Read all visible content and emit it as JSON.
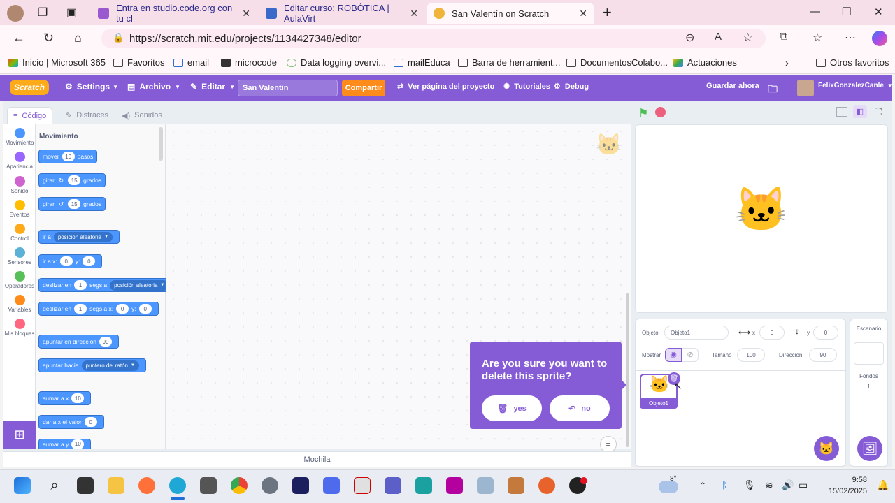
{
  "browser": {
    "tabs": [
      {
        "label": "Entra en studio.code.org con tu cl",
        "fav_color": "#9b59d0"
      },
      {
        "label": "Editar curso: ROBÓTICA | AulaVirt",
        "fav_color": "#3a6ac9"
      },
      {
        "label": "San Valentín on Scratch",
        "fav_color": "#f0b43a"
      }
    ],
    "url": "https://scratch.mit.edu/projects/1134427348/editor",
    "bookmarks": [
      "Inicio | Microsoft 365",
      "Favoritos",
      "email",
      "microcode",
      "Data logging overvi...",
      "mailEduca",
      "Barra de herramient...",
      "DocumentosColabo...",
      "Actuaciones"
    ],
    "other_favorites": "Otros favoritos"
  },
  "menubar": {
    "logo": "Scratch",
    "settings": "Settings",
    "file": "Archivo",
    "edit": "Editar",
    "project_title": "San Valentín",
    "share": "Compartir",
    "see_project": "Ver página del proyecto",
    "tutorials": "Tutoriales",
    "debug": "Debug",
    "save_now": "Guardar ahora",
    "username": "FelixGonzalezCanle"
  },
  "editor_tabs": {
    "code": "Código",
    "costumes": "Disfraces",
    "sounds": "Sonidos"
  },
  "categories": [
    {
      "label": "Movimiento",
      "color": "#4c97ff"
    },
    {
      "label": "Apariencia",
      "color": "#9966ff"
    },
    {
      "label": "Sonido",
      "color": "#cf63cf"
    },
    {
      "label": "Eventos",
      "color": "#ffbf00"
    },
    {
      "label": "Control",
      "color": "#ffab19"
    },
    {
      "label": "Sensores",
      "color": "#5cb1d6"
    },
    {
      "label": "Operadores",
      "color": "#59c059"
    },
    {
      "label": "Variables",
      "color": "#ff8c1a"
    },
    {
      "label": "Mis bloques",
      "color": "#ff6680"
    }
  ],
  "palette": {
    "heading": "Movimiento",
    "b_move": {
      "a": "mover",
      "v": "10",
      "b": "pasos"
    },
    "b_turn_r": {
      "a": "girar",
      "v": "15",
      "b": "grados"
    },
    "b_turn_l": {
      "a": "girar",
      "v": "15",
      "b": "grados"
    },
    "b_goto": {
      "a": "ir a",
      "dd": "posición aleatoria"
    },
    "b_gotoxy": {
      "a": "ir a x:",
      "x": "0",
      "y_lbl": "y:",
      "y": "0"
    },
    "b_glide": {
      "a": "deslizar en",
      "v": "1",
      "b": "segs a",
      "dd": "posición aleatoria"
    },
    "b_glidexy": {
      "a": "deslizar en",
      "v": "1",
      "b": "segs a x:",
      "x": "0",
      "y_lbl": "y:",
      "y": "0"
    },
    "b_point": {
      "a": "apuntar en dirección",
      "v": "90"
    },
    "b_towards": {
      "a": "apuntar hacia",
      "dd": "puntero del ratón"
    },
    "b_changex": {
      "a": "sumar a x",
      "v": "10"
    },
    "b_setx": {
      "a": "dar a x el valor",
      "v": "0"
    },
    "b_changey": {
      "a": "sumar a y",
      "v": "10"
    }
  },
  "backpack": "Mochila",
  "dialog": {
    "message": "Are you sure you want to delete this sprite?",
    "yes": "yes",
    "no": "no"
  },
  "sprite_info": {
    "sprite_label": "Objeto",
    "sprite_name": "Objeto1",
    "x_label": "x",
    "x": "0",
    "y_label": "y",
    "y": "0",
    "show_label": "Mostrar",
    "size_label": "Tamaño",
    "size": "100",
    "direction_label": "Dirección",
    "direction": "90",
    "thumb_name": "Objeto1"
  },
  "stage_pane": {
    "title": "Escenario",
    "backdrops_label": "Fondos",
    "backdrops_count": "1"
  },
  "taskbar": {
    "temp": "8°",
    "time": "9:58",
    "date": "15/02/2025"
  }
}
